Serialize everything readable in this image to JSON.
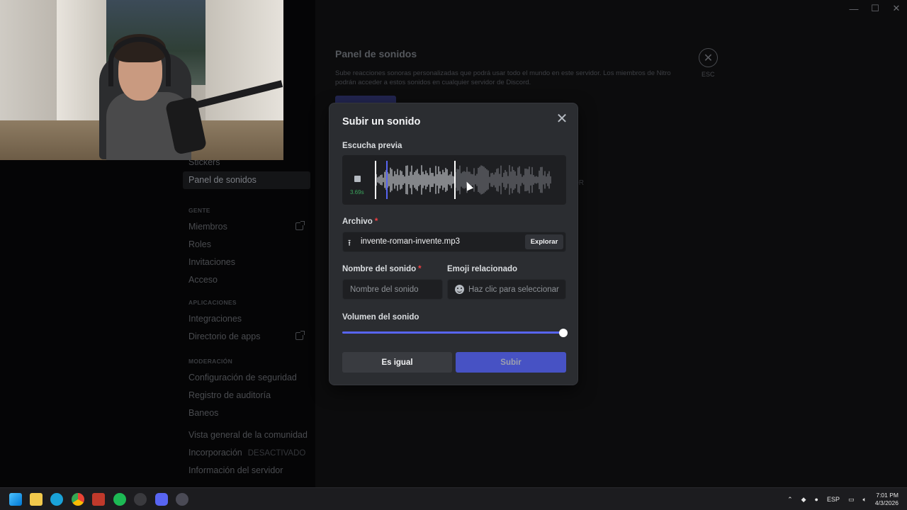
{
  "window_controls": {
    "minimize": "—",
    "maximize": "☐",
    "close": "✕"
  },
  "sidebar": {
    "items_top": [
      {
        "label": "Stickers"
      },
      {
        "label": "Panel de sonidos",
        "active": true
      }
    ],
    "section_people": "GENTE",
    "people_items": [
      {
        "label": "Miembros"
      },
      {
        "label": "Roles"
      },
      {
        "label": "Invitaciones"
      },
      {
        "label": "Acceso"
      }
    ],
    "section_apps": "APLICACIONES",
    "apps_items": [
      {
        "label": "Integraciones"
      },
      {
        "label": "Directorio de apps"
      }
    ],
    "section_mod": "MODERACIÓN",
    "mod_items": [
      {
        "label": "Configuración de seguridad"
      },
      {
        "label": "Registro de auditoría"
      },
      {
        "label": "Baneos"
      }
    ],
    "community_items": [
      {
        "label": "Vista general de la comunidad"
      },
      {
        "label": "Incorporación",
        "tag": "DESACTIVADO"
      },
      {
        "label": "Información del servidor"
      }
    ]
  },
  "settings": {
    "title": "Panel de sonidos",
    "description": "Sube reacciones sonoras personalizadas que podrá usar todo el mundo en este servidor. Los miembros de Nitro podrán acceder a estos sonidos en cualquier servidor de Discord.",
    "esc_label": "ESC",
    "partial_text": "OR"
  },
  "modal": {
    "title": "Subir un sonido",
    "preview_label": "Escucha previa",
    "preview_time": "3.69s",
    "file_label": "Archivo",
    "required_mark": "*",
    "file_name": "invente-roman-invente.mp3",
    "browse_label": "Explorar",
    "sound_name_label": "Nombre del sonido",
    "sound_name_placeholder": "Nombre del sonido",
    "emoji_label": "Emoji relacionado",
    "emoji_placeholder": "Haz clic para seleccionar",
    "volume_label": "Volumen del sonido",
    "volume_value": 1.0,
    "cancel_label": "Es igual",
    "submit_label": "Subir"
  },
  "taskbar": {
    "language": "ESP",
    "time": "7:01 PM",
    "date": "4/3/2026"
  },
  "colors": {
    "accent": "#5865f2",
    "submit_button": "#4752c4",
    "modal_bg": "#2b2d31",
    "required": "#f23f42",
    "time_green": "#3ba55c"
  }
}
